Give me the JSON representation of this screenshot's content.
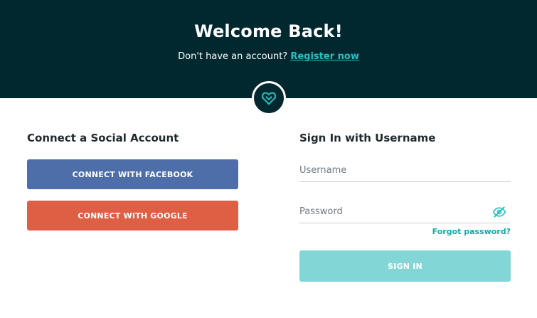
{
  "header": {
    "title": "Welcome Back!",
    "no_account_text": "Don't have an account? ",
    "register_link": "Register now"
  },
  "logo": {
    "icon": "heart-icon"
  },
  "social": {
    "title": "Connect a Social Account",
    "facebook_label": "CONNECT WITH FACEBOOK",
    "google_label": "CONNECT WITH GOOGLE"
  },
  "signin": {
    "title": "Sign In with Username",
    "username_placeholder": "Username",
    "username_value": "",
    "password_placeholder": "Password",
    "password_value": "",
    "password_toggle_icon": "eye-off-icon",
    "forgot_label": "Forgot password?",
    "submit_label": "SIGN IN"
  },
  "colors": {
    "header_bg": "#02282f",
    "accent": "#26c1c2",
    "facebook": "#4e6eaa",
    "google": "#df5f45",
    "signin_disabled": "#82d6d6"
  }
}
